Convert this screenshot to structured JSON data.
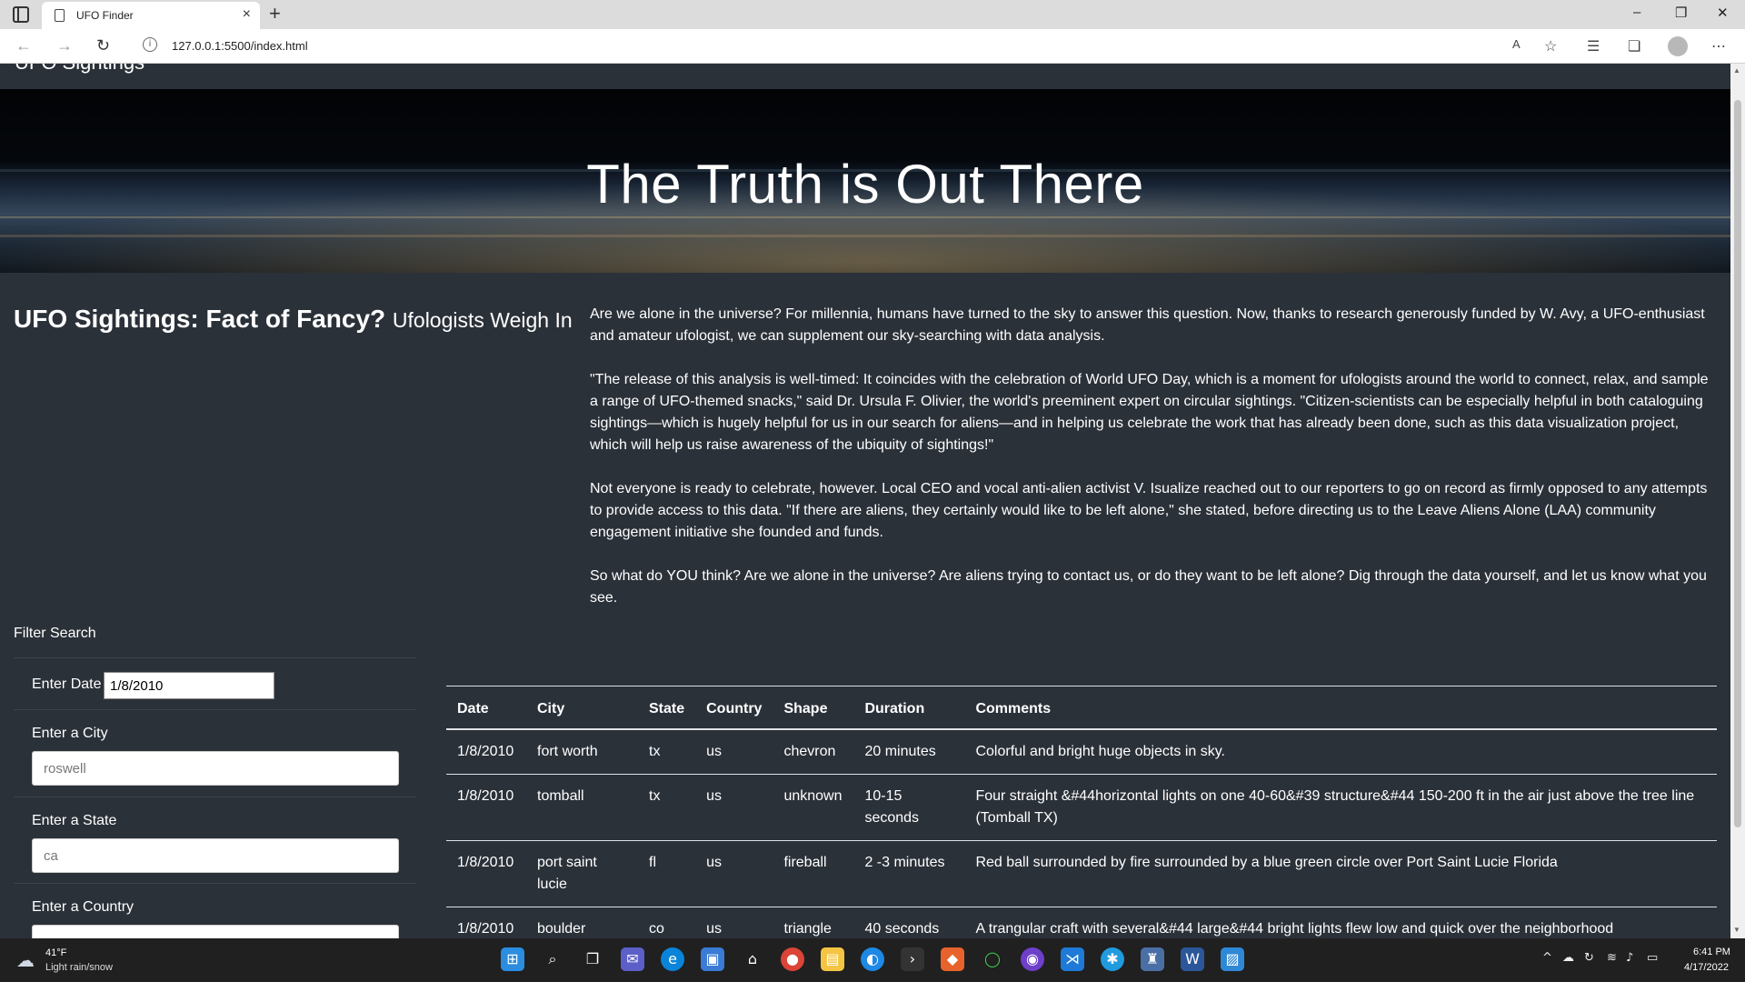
{
  "browser": {
    "tab_title": "UFO Finder",
    "url": "127.0.0.1:5500/index.html",
    "new_tab_symbol": "+",
    "close_symbol": "×"
  },
  "page": {
    "brand": "UFO Sightings",
    "hero_title": "The Truth is Out There",
    "headline_main": "UFO Sightings: Fact of Fancy?",
    "headline_sub": "Ufologists Weigh In",
    "paragraphs": [
      "Are we alone in the universe? For millennia, humans have turned to the sky to answer this question. Now, thanks to research generously funded by W. Avy, a UFO-enthusiast and amateur ufologist, we can supplement our sky-searching with data analysis.",
      "\"The release of this analysis is well-timed: It coincides with the celebration of World UFO Day, which is a moment for ufologists around the world to connect, relax, and sample a range of UFO-themed snacks,\" said Dr. Ursula F. Olivier, the world's preeminent expert on circular sightings. \"Citizen-scientists can be especially helpful in both cataloguing sightings—which is hugely helpful for us in our search for aliens—and in helping us celebrate the work that has already been done, such as this data visualization project, which will help us raise awareness of the ubiquity of sightings!\"",
      "Not everyone is ready to celebrate, however. Local CEO and vocal anti-alien activist V. Isualize reached out to our reporters to go on record as firmly opposed to any attempts to provide access to this data. \"If there are aliens, they certainly would like to be left alone,\" she stated, before directing us to the Leave Aliens Alone (LAA) community engagement initiative she founded and funds.",
      "So what do YOU think? Are we alone in the universe? Are aliens trying to contact us, or do they want to be left alone? Dig through the data yourself, and let us know what you see."
    ],
    "filter": {
      "title": "Filter Search",
      "date_label": "Enter Date",
      "date_value": "1/8/2010",
      "city_label": "Enter a City",
      "city_placeholder": "roswell",
      "state_label": "Enter a State",
      "state_placeholder": "ca",
      "country_label": "Enter a Country"
    },
    "table": {
      "headers": [
        "Date",
        "City",
        "State",
        "Country",
        "Shape",
        "Duration",
        "Comments"
      ],
      "rows": [
        [
          "1/8/2010",
          "fort worth",
          "tx",
          "us",
          "chevron",
          "20 minutes",
          "Colorful and bright huge objects in sky."
        ],
        [
          "1/8/2010",
          "tomball",
          "tx",
          "us",
          "unknown",
          "10-15 seconds",
          "Four straight &#44horizontal lights on one 40-60&#39 structure&#44 150-200 ft in the air just above the tree line (Tomball TX)"
        ],
        [
          "1/8/2010",
          "port saint lucie",
          "fl",
          "us",
          "fireball",
          "2 -3 minutes",
          "Red ball surrounded by fire surrounded by a blue green circle over Port Saint Lucie Florida"
        ],
        [
          "1/8/2010",
          "boulder",
          "co",
          "us",
          "triangle",
          "40 seconds",
          "A trangular craft with several&#44 large&#44 bright lights flew low and quick over the neighborhood"
        ]
      ]
    }
  },
  "taskbar": {
    "temperature": "41°F",
    "weather": "Light rain/snow",
    "time": "6:41 PM",
    "date": "4/17/2022"
  },
  "colors": {
    "page_bg": "#2b3139",
    "taskbar_bg": "#202020",
    "edge_blue": "#0a84d8"
  }
}
